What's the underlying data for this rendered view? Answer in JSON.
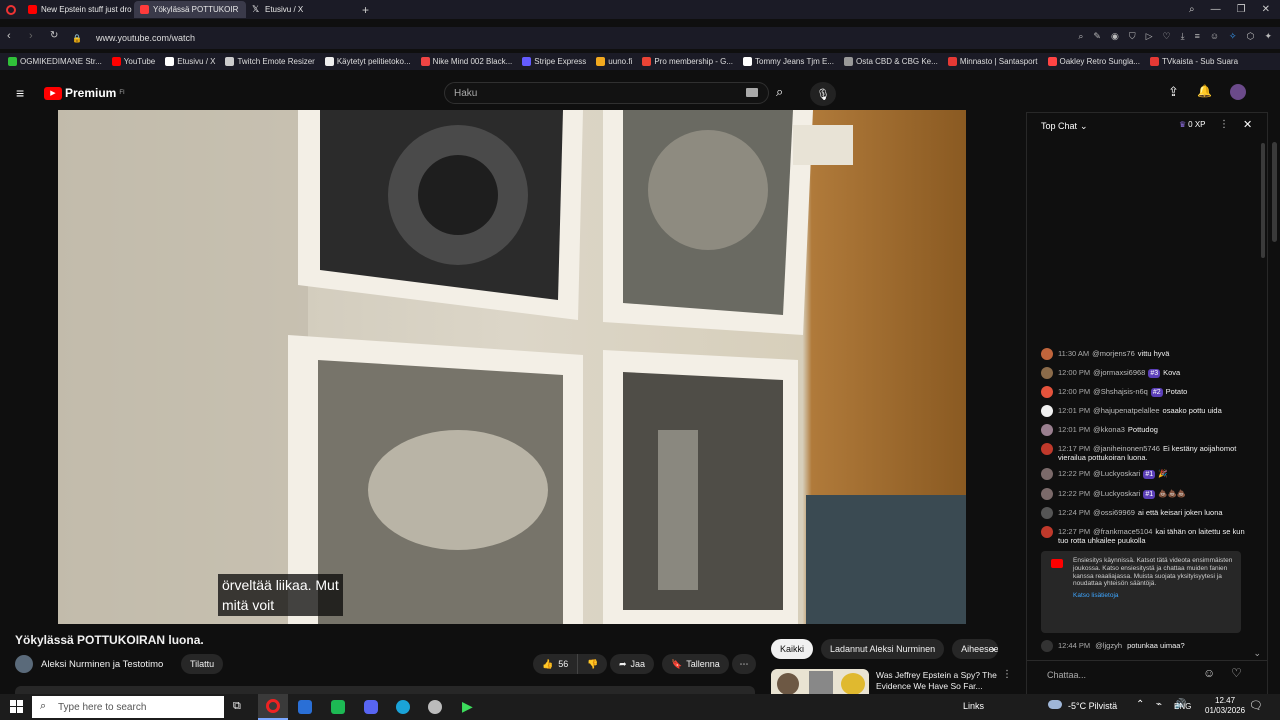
{
  "tabs": [
    {
      "label": "New Epstein stuff just dro",
      "color": "#ff0000",
      "active": false
    },
    {
      "label": "Yökylässä POTTUKOIR",
      "color": "#ff3b3b",
      "active": true
    },
    {
      "label": "Etusivu / X",
      "color": "#ffffff",
      "active": false
    }
  ],
  "url": "www.youtube.com/watch",
  "bookmarks": [
    {
      "label": "OGMIKEDIMANE Str...",
      "color": "#30c03a"
    },
    {
      "label": "YouTube",
      "color": "#ff0000"
    },
    {
      "label": "Etusivu / X",
      "color": "#ffffff"
    },
    {
      "label": "Twitch Emote Resizer",
      "color": "#cccccc"
    },
    {
      "label": "Käytetyt pelitietoko...",
      "color": "#eeeeee"
    },
    {
      "label": "Nike Mind 002 Black...",
      "color": "#e44"
    },
    {
      "label": "Stripe Express",
      "color": "#635bff"
    },
    {
      "label": "uuno.fi",
      "color": "#f2a91f"
    },
    {
      "label": "Pro membership - G...",
      "color": "#ea4335"
    },
    {
      "label": "Tommy Jeans Tjm E...",
      "color": "#ffffff"
    },
    {
      "label": "Osta CBD & CBG Ke...",
      "color": "#999999"
    },
    {
      "label": "Minnasto | Santasport",
      "color": "#e53935"
    },
    {
      "label": "Oakley Retro Sungla...",
      "color": "#f44"
    },
    {
      "label": "TVkaista - Sub Suara",
      "color": "#e53935"
    }
  ],
  "yt": {
    "logo": "Premium",
    "logo_sup": "FI",
    "search_placeholder": "Haku"
  },
  "video": {
    "caption_line1": "örveltää liikaa. Mut",
    "caption_line2": "mitä voit"
  },
  "meta": {
    "title": "Yökylässä POTTUKOIRAN luona.",
    "channel": "Aleksi Nurminen ja Testotimo",
    "subscribe": "Tilattu",
    "likes": "56",
    "share": "Jaa",
    "save": "Tallenna"
  },
  "filters": [
    "Kaikki",
    "Ladannut Aleksi Nurminen",
    "Aiheeseen"
  ],
  "rec": {
    "title_line1": "Was Jeffrey Epstein a Spy? The",
    "title_line2": "Evidence We Have So Far..."
  },
  "chat": {
    "header": "Top Chat",
    "xp": "0 XP",
    "input_placeholder": "Chattaa...",
    "messages": [
      {
        "time": "11:30 AM",
        "author": "@morjens76",
        "badge": "",
        "text": "vittu hyvä",
        "color": "#c0653c"
      },
      {
        "time": "12:00 PM",
        "author": "@jormaxsi6968",
        "badge": "#3",
        "text": "Kova",
        "color": "#8b6b4a"
      },
      {
        "time": "12:00 PM",
        "author": "@Shshajsis-n6q",
        "badge": "#2",
        "text": "Potato",
        "color": "#e5533c"
      },
      {
        "time": "12:01 PM",
        "author": "@hajupenatpelallee",
        "badge": "",
        "text": "osaako pottu uida",
        "color": "#f0f0f0"
      },
      {
        "time": "12:01 PM",
        "author": "@kkona3",
        "badge": "",
        "text": "Pottudog",
        "color": "#9a7f8f"
      },
      {
        "time": "12:17 PM",
        "author": "@janiheinonen5746",
        "badge": "",
        "text": "Ei kestäny aoijahomot vierailua pottukoiran luona.",
        "color": "#c0392b"
      },
      {
        "time": "12:22 PM",
        "author": "@Luckyoskari",
        "badge": "#1",
        "text": "🎉",
        "color": "#7b6a6a"
      },
      {
        "time": "12:22 PM",
        "author": "@Luckyoskari",
        "badge": "#1",
        "text": "💩💩💩",
        "color": "#7b6a6a"
      },
      {
        "time": "12:24 PM",
        "author": "@ossi69969",
        "badge": "",
        "text": "ai että keisari joken luona",
        "color": "#555555"
      },
      {
        "time": "12:27 PM",
        "author": "@frankmace5104",
        "badge": "",
        "text": "kai tähän on laitettu se kun tuo rotta uhkailee puukolla",
        "color": "#c0392b"
      }
    ],
    "notice": "Ensiesitys käynnissä. Katsot tätä videota ensimmäisten joukossa. Katso ensiesitystä ja chattaa muiden fanien kanssa reaaliajassa. Muista suojata yksityisyytesi ja noudattaa yhteisön sääntöjä.",
    "notice_link": "Katso lisätietoja",
    "last": {
      "time": "12:44 PM",
      "author": "@ljgzyh",
      "text": "potunkaa uimaa?"
    }
  },
  "taskbar": {
    "search_placeholder": "Type here to search",
    "links": "Links",
    "weather": "-5°C Pilvistä",
    "lang": "ENG",
    "time": "12.47",
    "date": "01/03/2026"
  }
}
